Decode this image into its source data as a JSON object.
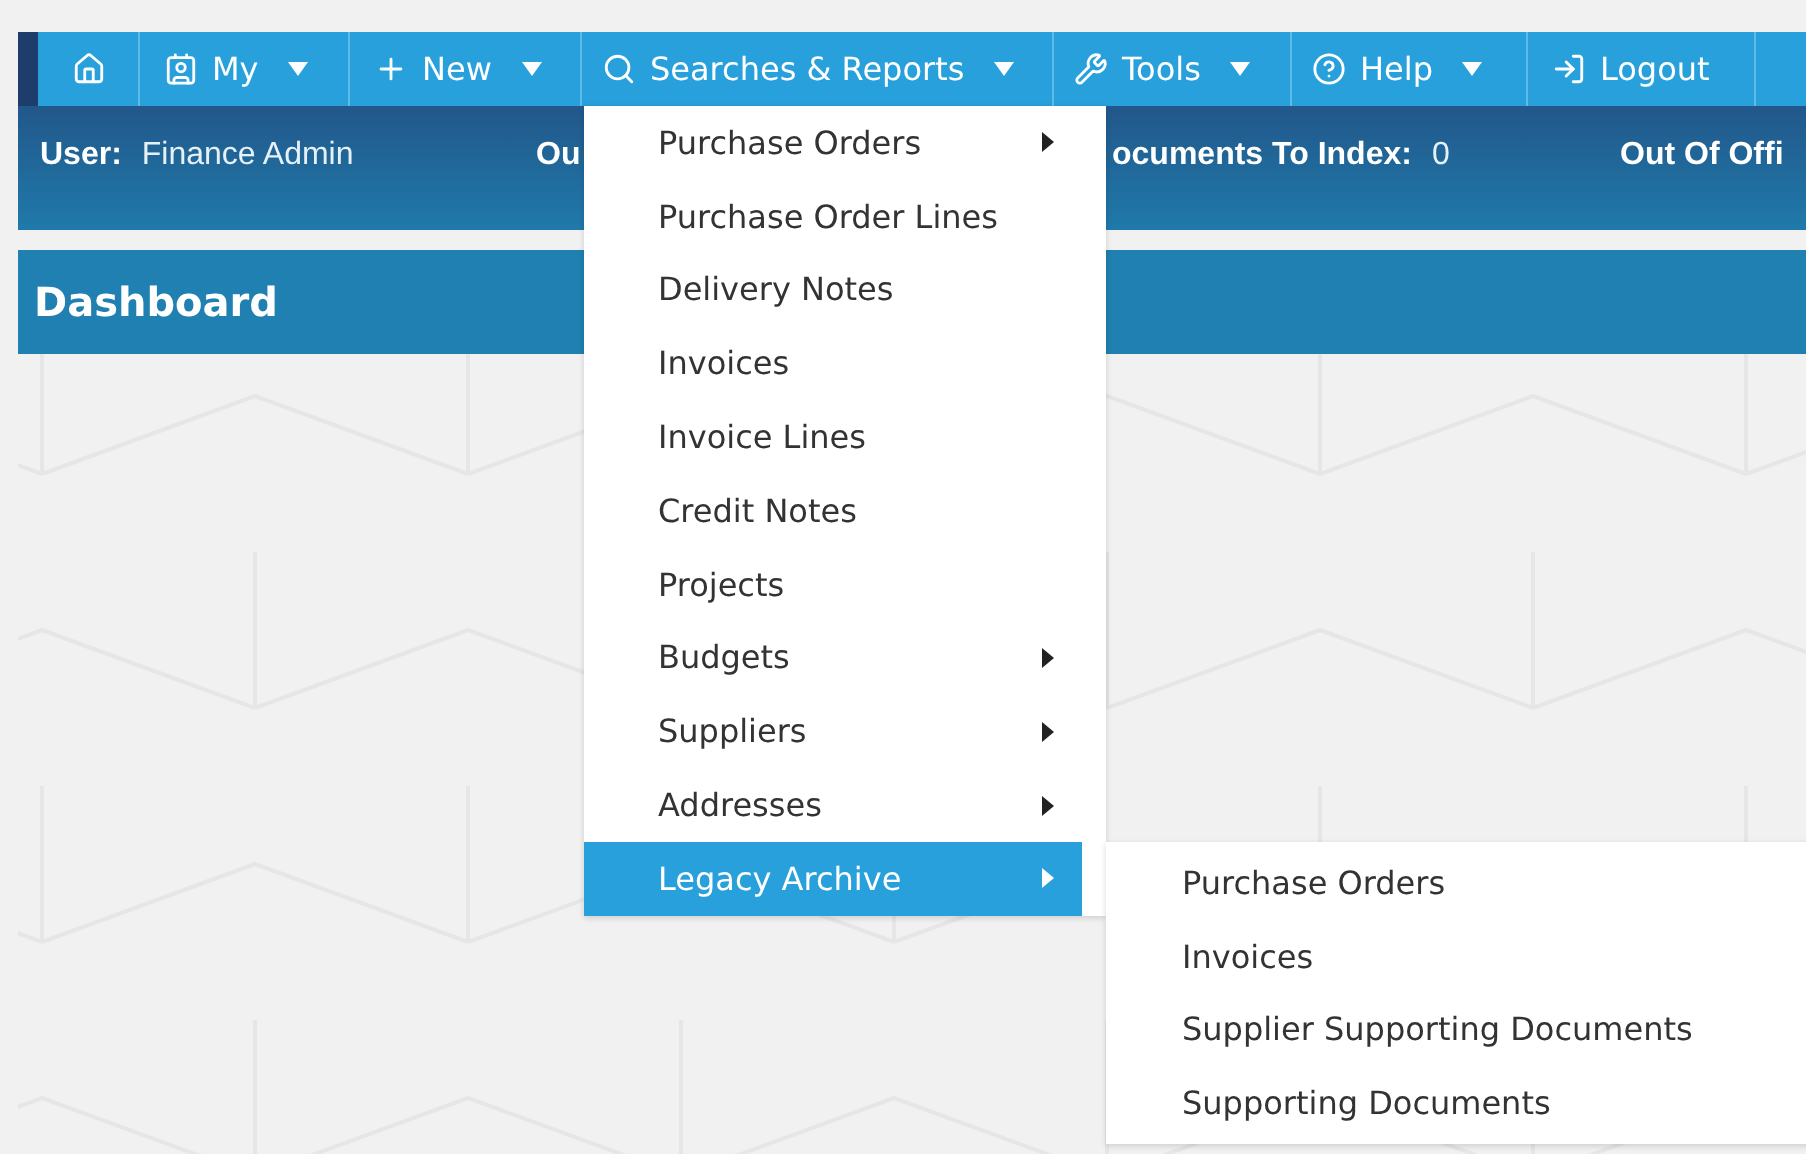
{
  "navbar": {
    "items": [
      {
        "kind": "icon"
      },
      {
        "kind": "menu",
        "label": "My",
        "dropdown": true
      },
      {
        "kind": "menu",
        "label": "New",
        "dropdown": true
      },
      {
        "kind": "menu",
        "label": "Searches & Reports",
        "dropdown": true
      },
      {
        "kind": "menu",
        "label": "Tools",
        "dropdown": true
      },
      {
        "kind": "menu",
        "label": "Help",
        "dropdown": true
      },
      {
        "kind": "menu",
        "label": "Logout",
        "dropdown": false
      }
    ]
  },
  "info_bar": [
    {
      "label": "User:",
      "value": "Finance Admin"
    },
    {
      "label": "Ou"
    },
    {
      "label": "ocuments To Index:",
      "value": "0"
    },
    {
      "label": "Out Of Offi"
    }
  ],
  "page_title": "Dashboard",
  "dropdown_menu": {
    "items": [
      {
        "label": "Purchase Orders",
        "submenu": true,
        "selected": false
      },
      {
        "label": "Purchase Order Lines",
        "submenu": false,
        "selected": false
      },
      {
        "label": "Delivery Notes",
        "submenu": false,
        "selected": false
      },
      {
        "label": "Invoices",
        "submenu": false,
        "selected": false
      },
      {
        "label": "Invoice Lines",
        "submenu": false,
        "selected": false
      },
      {
        "label": "Credit Notes",
        "submenu": false,
        "selected": false
      },
      {
        "label": "Projects",
        "submenu": false,
        "selected": false
      },
      {
        "label": "Budgets",
        "submenu": true,
        "selected": false
      },
      {
        "label": "Suppliers",
        "submenu": true,
        "selected": false
      },
      {
        "label": "Addresses",
        "submenu": true,
        "selected": false
      },
      {
        "label": "Legacy Archive",
        "submenu": true,
        "selected": true
      }
    ]
  },
  "submenu": {
    "items": [
      {
        "label": "Purchase Orders"
      },
      {
        "label": "Invoices"
      },
      {
        "label": "Supplier Supporting Documents"
      },
      {
        "label": "Supporting Documents"
      }
    ]
  }
}
